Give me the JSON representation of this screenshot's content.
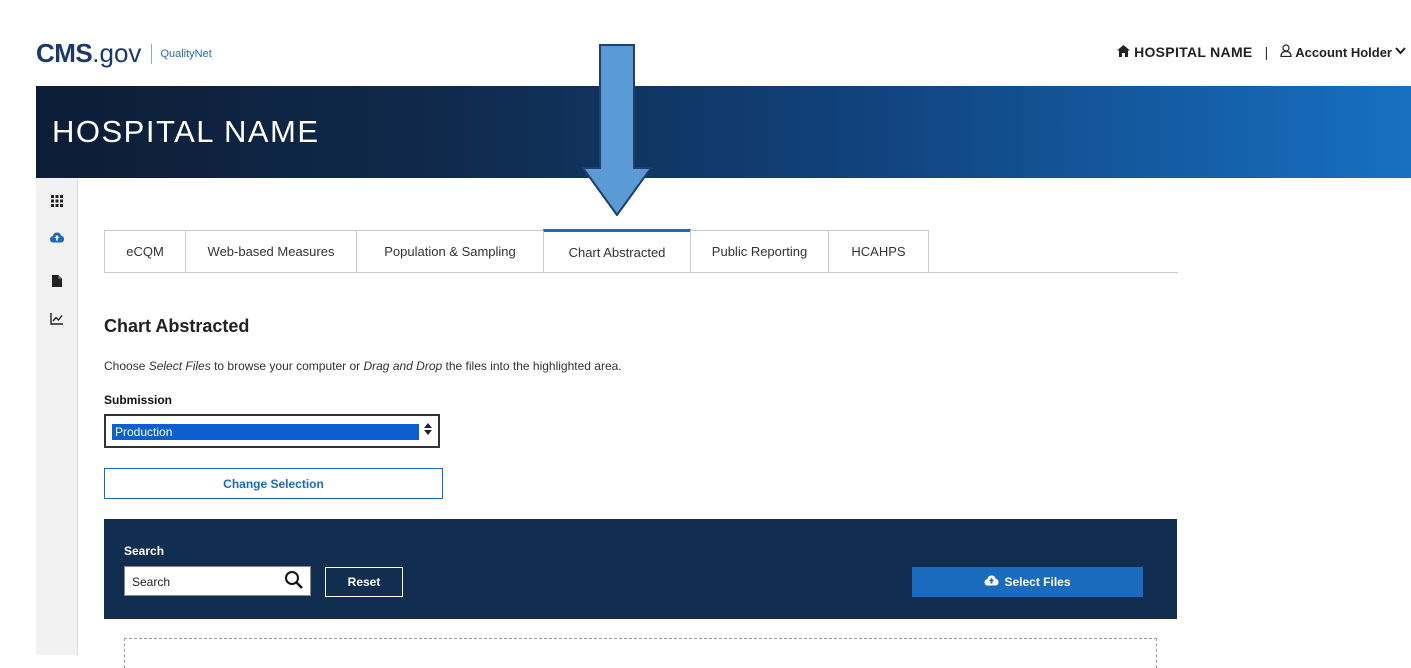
{
  "header": {
    "logo_main": "CMS",
    "logo_domain": ".gov",
    "logo_sub": "QualityNet",
    "hospital_name": "HOSPITAL NAME",
    "separator": "|",
    "account_label": "Account Holder"
  },
  "banner": {
    "title": "HOSPITAL NAME"
  },
  "sidebar": {
    "items": [
      {
        "icon": "grid-icon",
        "active": false
      },
      {
        "icon": "cloud-upload-icon",
        "active": true
      },
      {
        "icon": "document-icon",
        "active": false
      },
      {
        "icon": "chart-icon",
        "active": false
      }
    ]
  },
  "tabs": [
    {
      "label": "eCQM"
    },
    {
      "label": "Web-based Measures"
    },
    {
      "label": "Population & Sampling"
    },
    {
      "label": "Chart Abstracted",
      "active": true
    },
    {
      "label": "Public Reporting"
    },
    {
      "label": "HCAHPS"
    }
  ],
  "main": {
    "heading": "Chart Abstracted",
    "instr_part1": "Choose ",
    "instr_em1": "Select Files",
    "instr_part2": " to browse your computer or ",
    "instr_em2": "Drag and Drop",
    "instr_part3": " the files into the highlighted area.",
    "submission_label": "Submission",
    "submission_value": "Production",
    "change_selection": "Change Selection"
  },
  "panel": {
    "search_label": "Search",
    "search_placeholder": "Search",
    "reset": "Reset",
    "select_files": "Select Files"
  },
  "colors": {
    "brand_dark": "#112e51",
    "accent_blue": "#1a6bbd",
    "arrow_fill": "#5b9bd5"
  }
}
